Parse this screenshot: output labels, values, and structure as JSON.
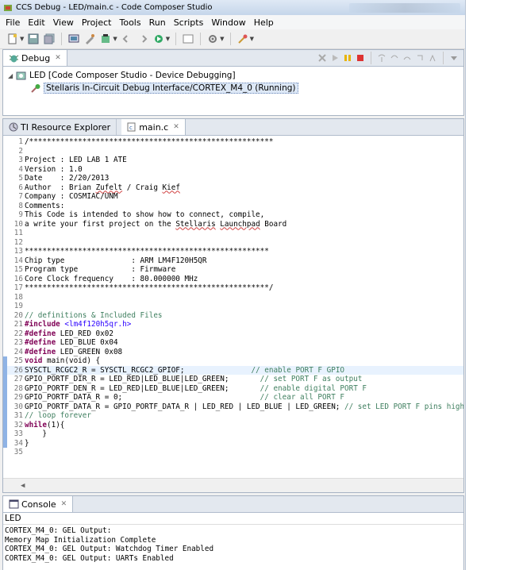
{
  "window": {
    "title": "CCS Debug - LED/main.c - Code Composer Studio"
  },
  "menu": [
    "File",
    "Edit",
    "View",
    "Project",
    "Tools",
    "Run",
    "Scripts",
    "Window",
    "Help"
  ],
  "debug_view": {
    "tab_label": "Debug",
    "tree": [
      {
        "label": "LED [Code Composer Studio - Device Debugging]"
      },
      {
        "label": "Stellaris In-Circuit Debug Interface/CORTEX_M4_0 (Running)"
      }
    ]
  },
  "editor": {
    "tabs": [
      {
        "label": "TI Resource Explorer"
      },
      {
        "label": "main.c"
      }
    ],
    "lines": [
      {
        "n": "1",
        "t": "/*******************************************************"
      },
      {
        "n": "2",
        "t": ""
      },
      {
        "n": "3",
        "t": "Project : LED LAB 1 ATE"
      },
      {
        "n": "4",
        "t": "Version : 1.0"
      },
      {
        "n": "5",
        "t": "Date    : 2/20/2013"
      },
      {
        "n": "6",
        "t": "Author  : Brian Zufelt / Craig Kief"
      },
      {
        "n": "7",
        "t": "Company : COSMIAC/UNM"
      },
      {
        "n": "8",
        "t": "Comments:"
      },
      {
        "n": "9",
        "t": "This Code is intended to show how to connect, compile,"
      },
      {
        "n": "10",
        "t": "a write your first project on the Stellaris Launchpad Board"
      },
      {
        "n": "11",
        "t": ""
      },
      {
        "n": "12",
        "t": ""
      },
      {
        "n": "13",
        "t": "*******************************************************"
      },
      {
        "n": "14",
        "t": "Chip type               : ARM LM4F120H5QR"
      },
      {
        "n": "15",
        "t": "Program type            : Firmware"
      },
      {
        "n": "16",
        "t": "Core Clock frequency    : 80.000000 MHz"
      },
      {
        "n": "17",
        "t": "*******************************************************/"
      },
      {
        "n": "18",
        "t": ""
      },
      {
        "n": "19",
        "t": ""
      },
      {
        "n": "20",
        "t": "// definitions & Included Files"
      },
      {
        "n": "21",
        "t": "#include <lm4f120h5qr.h>"
      },
      {
        "n": "22",
        "t": "#define LED_RED 0x02"
      },
      {
        "n": "23",
        "t": "#define LED_BLUE 0x04"
      },
      {
        "n": "24",
        "t": "#define LED_GREEN 0x08"
      },
      {
        "n": "25",
        "t": "void main(void) {"
      },
      {
        "n": "26",
        "t": "SYSCTL_RCGC2_R = SYSCTL_RCGC2_GPIOF;               // enable PORT F GPIO"
      },
      {
        "n": "27",
        "t": "GPIO_PORTF_DIR_R = LED_RED|LED_BLUE|LED_GREEN;       // set PORT F as output"
      },
      {
        "n": "28",
        "t": "GPIO_PORTF_DEN_R = LED_RED|LED_BLUE|LED_GREEN;       // enable digital PORT F"
      },
      {
        "n": "29",
        "t": "GPIO_PORTF_DATA_R = 0;                               // clear all PORT F"
      },
      {
        "n": "30",
        "t": "GPIO_PORTF_DATA_R = GPIO_PORTF_DATA_R | LED_RED | LED_BLUE | LED_GREEN; // set LED PORT F pins high"
      },
      {
        "n": "31",
        "t": "// loop forever"
      },
      {
        "n": "32",
        "t": "while(1){"
      },
      {
        "n": "33",
        "t": "    }"
      },
      {
        "n": "34",
        "t": "}"
      },
      {
        "n": "35",
        "t": ""
      }
    ]
  },
  "console": {
    "tab_label": "Console",
    "name": "LED",
    "lines": [
      "CORTEX_M4_0: GEL Output:",
      "Memory Map Initialization Complete",
      "CORTEX_M4_0: GEL Output: Watchdog Timer Enabled",
      "CORTEX_M4_0: GEL Output: UARTs Enabled"
    ]
  },
  "colors": {
    "accent": "#8fb3e5",
    "comment": "#3f7f5f",
    "keyword": "#7f0055"
  }
}
